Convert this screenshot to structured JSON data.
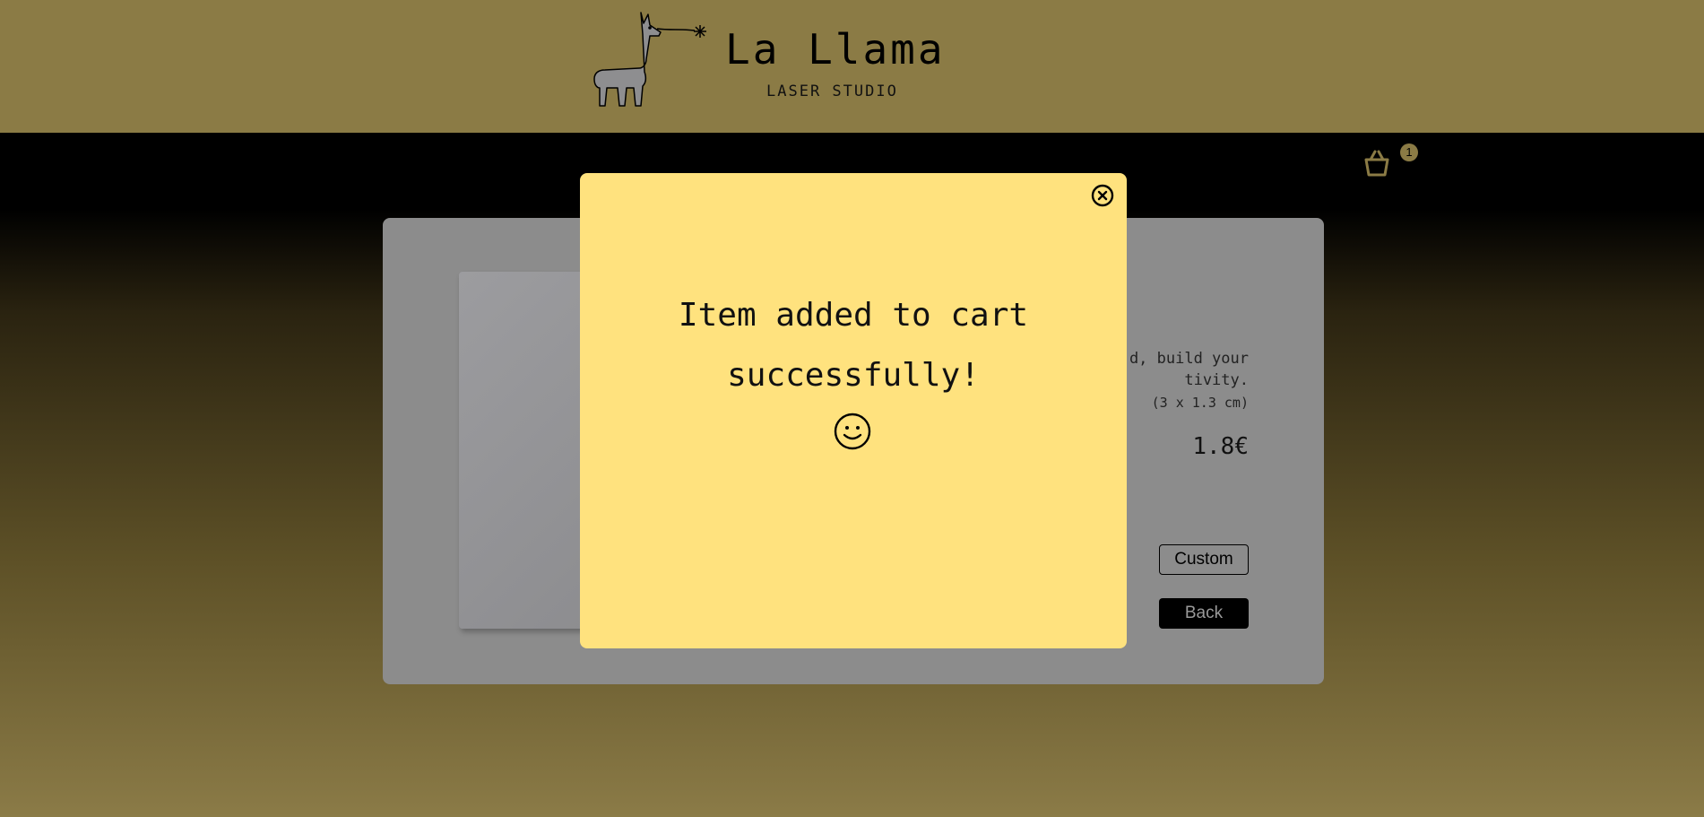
{
  "header": {
    "brand_title": "La Llama",
    "brand_subtitle": "LASER STUDIO",
    "logo_icon": "llama-laser-icon"
  },
  "cart": {
    "icon": "basket-icon",
    "count": "1"
  },
  "product": {
    "description_partial": "d, build your\ntivity.",
    "size": "(3 x 1.3 cm)",
    "price": "1.8€",
    "custom_label": "Custom",
    "back_label": "Back"
  },
  "modal": {
    "message_line1": "Item added to cart",
    "message_line2": "successfully!",
    "close_icon": "close-icon",
    "smile_icon": "smiley-icon"
  },
  "colors": {
    "header_bg": "#8b7b45",
    "modal_bg": "#ffe27e",
    "card_bg": "#8c8c8c",
    "accent": "#8b7b45"
  }
}
